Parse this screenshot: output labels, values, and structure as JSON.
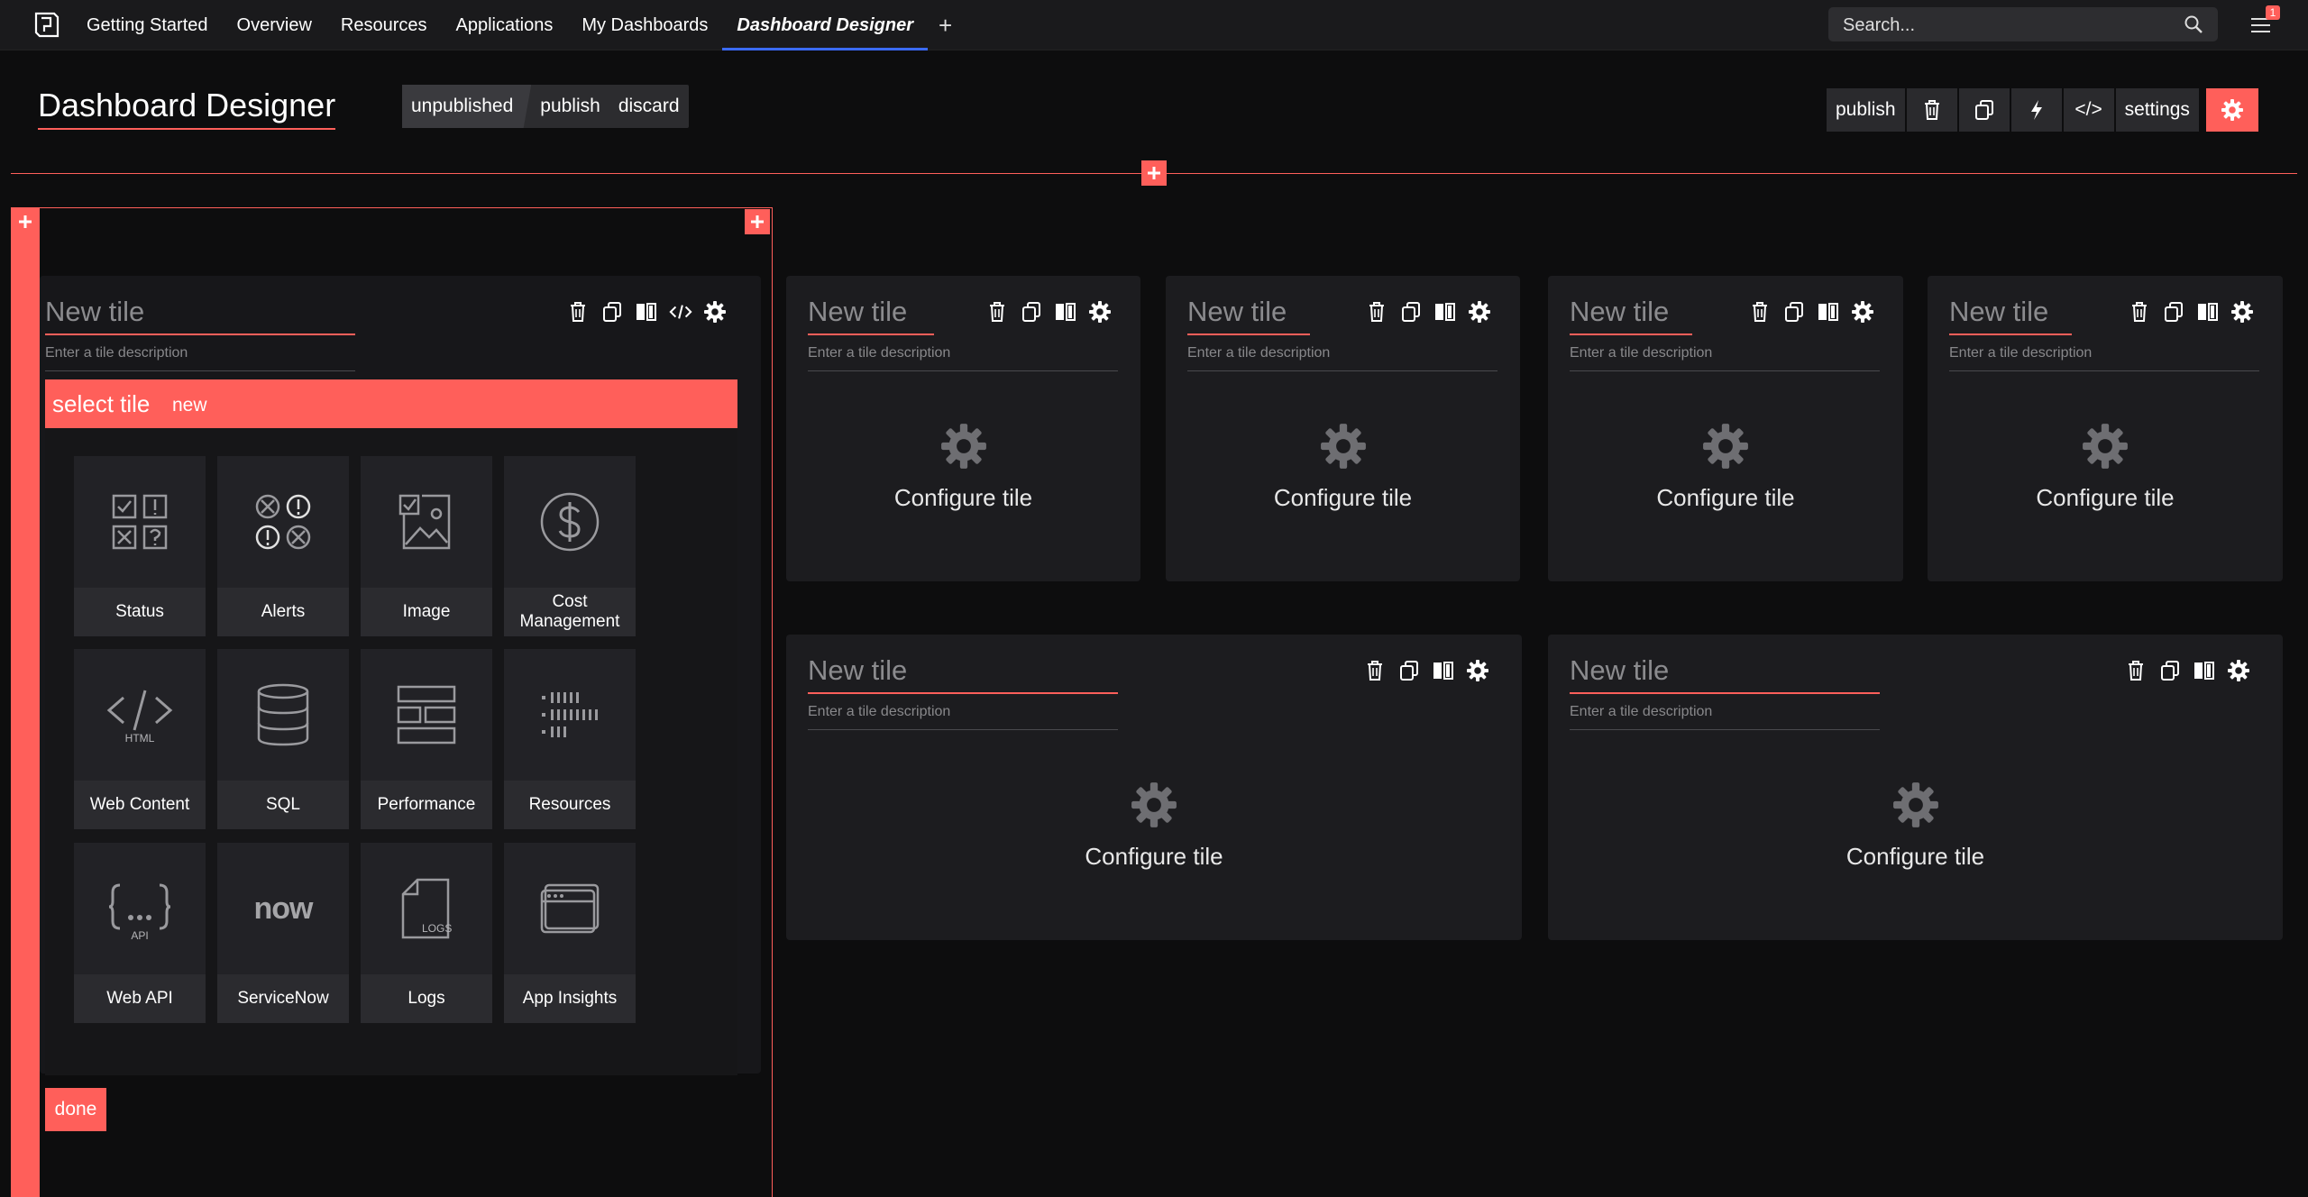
{
  "nav": {
    "items": [
      "Getting Started",
      "Overview",
      "Resources",
      "Applications",
      "My Dashboards",
      "Dashboard Designer"
    ],
    "active_index": 5,
    "add_label": "+"
  },
  "search": {
    "placeholder": "Search..."
  },
  "notifications": {
    "count": "1"
  },
  "header": {
    "title": "Dashboard Designer",
    "status": "unpublished",
    "publish": "publish",
    "discard": "discard"
  },
  "toolbar": {
    "publish": "publish",
    "code": "</>",
    "settings": "settings"
  },
  "selected_tile": {
    "title": "New tile",
    "description_placeholder": "Enter a tile description",
    "select_label": "select tile",
    "new_label": "new",
    "done_label": "done",
    "options": [
      {
        "label": "Status",
        "icon": "status-grid-icon"
      },
      {
        "label": "Alerts",
        "icon": "alerts-icon"
      },
      {
        "label": "Image",
        "icon": "image-icon"
      },
      {
        "label": "Cost Management",
        "icon": "dollar-icon"
      },
      {
        "label": "Web Content",
        "icon": "html-icon",
        "sublabel": "HTML"
      },
      {
        "label": "SQL",
        "icon": "database-icon"
      },
      {
        "label": "Performance",
        "icon": "performance-icon"
      },
      {
        "label": "Resources",
        "icon": "resources-icon"
      },
      {
        "label": "Web API",
        "icon": "api-icon",
        "sublabel": "API"
      },
      {
        "label": "ServiceNow",
        "icon": "servicenow-icon",
        "sublabel": "now"
      },
      {
        "label": "Logs",
        "icon": "logs-icon",
        "sublabel": "LOGS"
      },
      {
        "label": "App Insights",
        "icon": "app-insights-icon"
      }
    ]
  },
  "tiles": [
    {
      "title": "New tile",
      "description_placeholder": "Enter a tile description",
      "configure_label": "Configure tile"
    },
    {
      "title": "New tile",
      "description_placeholder": "Enter a tile description",
      "configure_label": "Configure tile"
    },
    {
      "title": "New tile",
      "description_placeholder": "Enter a tile description",
      "configure_label": "Configure tile"
    },
    {
      "title": "New tile",
      "description_placeholder": "Enter a tile description",
      "configure_label": "Configure tile"
    },
    {
      "title": "New tile",
      "description_placeholder": "Enter a tile description",
      "configure_label": "Configure tile"
    },
    {
      "title": "New tile",
      "description_placeholder": "Enter a tile description",
      "configure_label": "Configure tile"
    }
  ],
  "colors": {
    "accent": "#ff5f5a",
    "tab_underline": "#3b6bff",
    "background": "#0d0d0e",
    "tile": "#1c1c1f"
  }
}
